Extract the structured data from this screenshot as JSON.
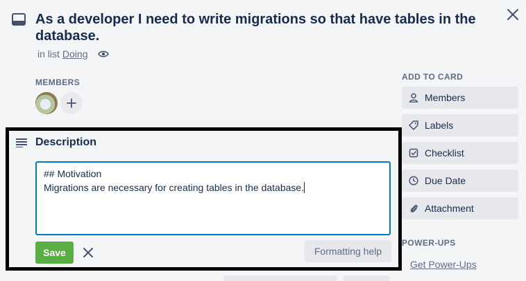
{
  "card": {
    "title": "As a developer I need to write migrations so that have tables in the database.",
    "in_list_prefix": "in list",
    "list_name": "Doing"
  },
  "members": {
    "label": "MEMBERS"
  },
  "description": {
    "title": "Description",
    "text": "## Motivation\nMigrations are necessary for creating tables in the database.",
    "save_label": "Save",
    "formatting_help_label": "Formatting help"
  },
  "sidebar": {
    "add_to_card_label": "ADD TO CARD",
    "items": [
      {
        "label": "Members",
        "icon": "person-icon"
      },
      {
        "label": "Labels",
        "icon": "tag-icon"
      },
      {
        "label": "Checklist",
        "icon": "checkbox-icon"
      },
      {
        "label": "Due Date",
        "icon": "clock-icon"
      },
      {
        "label": "Attachment",
        "icon": "paperclip-icon"
      }
    ],
    "power_ups_label": "POWER-UPS",
    "get_power_ups_label": "Get Power-Ups"
  },
  "colors": {
    "save_green": "#5aac44",
    "focus_blue": "#0079bf",
    "highlight_border": "#000000"
  }
}
